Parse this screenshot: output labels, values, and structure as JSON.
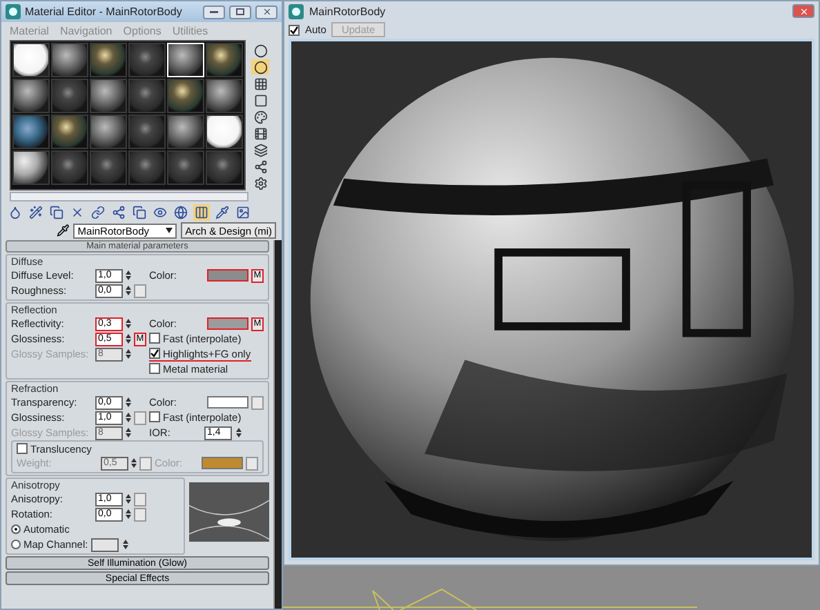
{
  "editor": {
    "title": "Material Editor - MainRotorBody",
    "menu": [
      "Material",
      "Navigation",
      "Options",
      "Utilities"
    ],
    "slots": [
      {
        "kind": "white",
        "selected": false
      },
      {
        "kind": "gray",
        "selected": false
      },
      {
        "kind": "colorful",
        "selected": false
      },
      {
        "kind": "dark",
        "selected": false
      },
      {
        "kind": "gray",
        "selected": true
      },
      {
        "kind": "colorful",
        "selected": false
      },
      {
        "kind": "gray",
        "selected": false
      },
      {
        "kind": "dark",
        "selected": false
      },
      {
        "kind": "gray",
        "selected": false
      },
      {
        "kind": "dark",
        "selected": false
      },
      {
        "kind": "colorful",
        "selected": false
      },
      {
        "kind": "gray",
        "selected": false
      },
      {
        "kind": "blue",
        "selected": false
      },
      {
        "kind": "colorful",
        "selected": false
      },
      {
        "kind": "gray",
        "selected": false
      },
      {
        "kind": "dark",
        "selected": false
      },
      {
        "kind": "gray",
        "selected": false
      },
      {
        "kind": "white",
        "selected": false
      },
      {
        "kind": "light",
        "selected": false
      },
      {
        "kind": "dark",
        "selected": false
      },
      {
        "kind": "dark",
        "selected": false
      },
      {
        "kind": "dark",
        "selected": false
      },
      {
        "kind": "dark",
        "selected": false
      },
      {
        "kind": "dark",
        "selected": false
      }
    ],
    "material_name": "MainRotorBody",
    "material_type": "Arch & Design (mi)",
    "rollout_title": "Main material parameters",
    "groups": [
      {
        "title": "Diffuse",
        "rows": [
          {
            "field": {
              "label": "Diffuse Level:",
              "value": "1,0",
              "map_button": false,
              "highlighted": false,
              "disabled": false
            },
            "side": {
              "kind": "color",
              "label": "Color:",
              "color": "#8c8c8c",
              "map_label": "M",
              "highlighted": true
            }
          },
          {
            "field": {
              "label": "Roughness:",
              "value": "0,0",
              "map_button": true,
              "highlighted": false,
              "disabled": false
            }
          }
        ]
      },
      {
        "title": "Reflection",
        "rows": [
          {
            "field": {
              "label": "Reflectivity:",
              "value": "0,3",
              "map_button": false,
              "highlighted": true,
              "disabled": false
            },
            "side": {
              "kind": "color",
              "label": "Color:",
              "color": "#9c9c9c",
              "map_label": "M",
              "highlighted": true
            }
          },
          {
            "field": {
              "label": "Glossiness:",
              "value": "0,5",
              "map_button": true,
              "map_label": "M",
              "highlighted": true,
              "disabled": false
            },
            "side": {
              "kind": "checkbox",
              "label": "Fast (interpolate)",
              "checked": false,
              "highlighted": false
            }
          },
          {
            "field": {
              "label": "Glossy Samples:",
              "value": "8",
              "map_button": false,
              "highlighted": false,
              "disabled": true
            },
            "side": {
              "kind": "checkbox",
              "label": "Highlights+FG only",
              "checked": true,
              "highlighted": true
            }
          },
          {
            "side": {
              "kind": "checkbox",
              "label": "Metal material",
              "checked": false,
              "highlighted": false
            }
          }
        ]
      },
      {
        "title": "Refraction",
        "rows": [
          {
            "field": {
              "label": "Transparency:",
              "value": "0,0",
              "map_button": false,
              "highlighted": false,
              "disabled": false
            },
            "side": {
              "kind": "color",
              "label": "Color:",
              "color": "#ffffff",
              "highlighted": false
            }
          },
          {
            "field": {
              "label": "Glossiness:",
              "value": "1,0",
              "map_button": true,
              "highlighted": false,
              "disabled": false
            },
            "side": {
              "kind": "checkbox",
              "label": "Fast (interpolate)",
              "checked": false,
              "highlighted": false
            }
          },
          {
            "field": {
              "label": "Glossy Samples:",
              "value": "8",
              "map_button": false,
              "highlighted": false,
              "disabled": true
            },
            "side": {
              "kind": "spinner",
              "label": "IOR:",
              "value": "1,4"
            }
          }
        ],
        "sub": {
          "label": "Translucency",
          "checked": false,
          "rows": [
            {
              "field": {
                "label": "Weight:",
                "value": "0,5",
                "map_button": true,
                "highlighted": false,
                "disabled": true
              },
              "side": {
                "kind": "color",
                "label": "Color:",
                "color": "#c08a30",
                "highlighted": false,
                "disabled": true
              }
            }
          ]
        }
      }
    ],
    "anisotropy": {
      "title": "Anisotropy",
      "fields": [
        {
          "label": "Anisotropy:",
          "value": "1,0",
          "map_button": true,
          "highlighted": false,
          "disabled": false
        },
        {
          "label": "Rotation:",
          "value": "0,0",
          "map_button": true,
          "highlighted": false,
          "disabled": false
        }
      ],
      "radios": [
        {
          "label": "Automatic",
          "selected": true
        },
        {
          "label": "Map Channel:",
          "selected": false
        }
      ]
    },
    "rollouts": [
      "Self Illumination (Glow)",
      "Special Effects"
    ]
  },
  "viewer": {
    "title": "MainRotorBody",
    "auto": {
      "label": "Auto",
      "checked": true
    },
    "update": "Update"
  }
}
